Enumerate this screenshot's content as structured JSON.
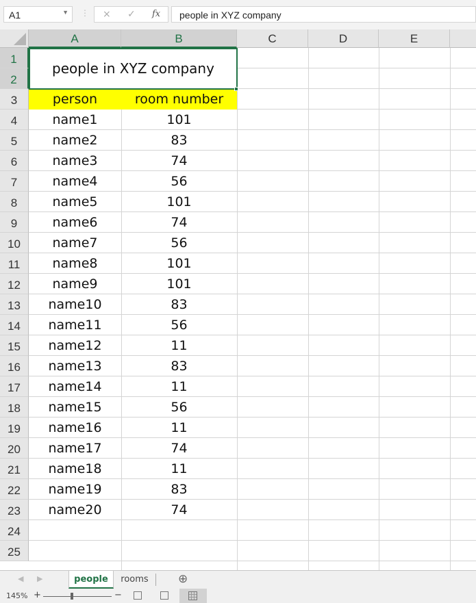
{
  "formula_bar": {
    "name_box": "A1",
    "cancel_icon": "×",
    "enter_icon": "✓",
    "fx_label": "fx",
    "formula": "people in XYZ company"
  },
  "columns": [
    "A",
    "B",
    "C",
    "D",
    "E"
  ],
  "rows": [
    "1",
    "2",
    "3",
    "4",
    "5",
    "6",
    "7",
    "8",
    "9",
    "10",
    "11",
    "12",
    "13",
    "14",
    "15",
    "16",
    "17",
    "18",
    "19",
    "20",
    "21",
    "22",
    "23",
    "24",
    "25"
  ],
  "sheet": {
    "title": "people in XYZ company",
    "headers": [
      "person",
      "room number"
    ],
    "header_fill": "#ffff00",
    "records": [
      [
        "name1",
        "101"
      ],
      [
        "name2",
        "83"
      ],
      [
        "name3",
        "74"
      ],
      [
        "name4",
        "56"
      ],
      [
        "name5",
        "101"
      ],
      [
        "name6",
        "74"
      ],
      [
        "name7",
        "56"
      ],
      [
        "name8",
        "101"
      ],
      [
        "name9",
        "101"
      ],
      [
        "name10",
        "83"
      ],
      [
        "name11",
        "56"
      ],
      [
        "name12",
        "11"
      ],
      [
        "name13",
        "83"
      ],
      [
        "name14",
        "11"
      ],
      [
        "name15",
        "56"
      ],
      [
        "name16",
        "11"
      ],
      [
        "name17",
        "74"
      ],
      [
        "name18",
        "11"
      ],
      [
        "name19",
        "83"
      ],
      [
        "name20",
        "74"
      ]
    ]
  },
  "tabs": [
    {
      "label": "people",
      "active": true
    },
    {
      "label": "rooms",
      "active": false
    }
  ],
  "add_sheet_icon": "⊕",
  "status": {
    "zoom": "145%",
    "zoom_in": "+",
    "zoom_out": "−"
  },
  "accent_color": "#217346"
}
